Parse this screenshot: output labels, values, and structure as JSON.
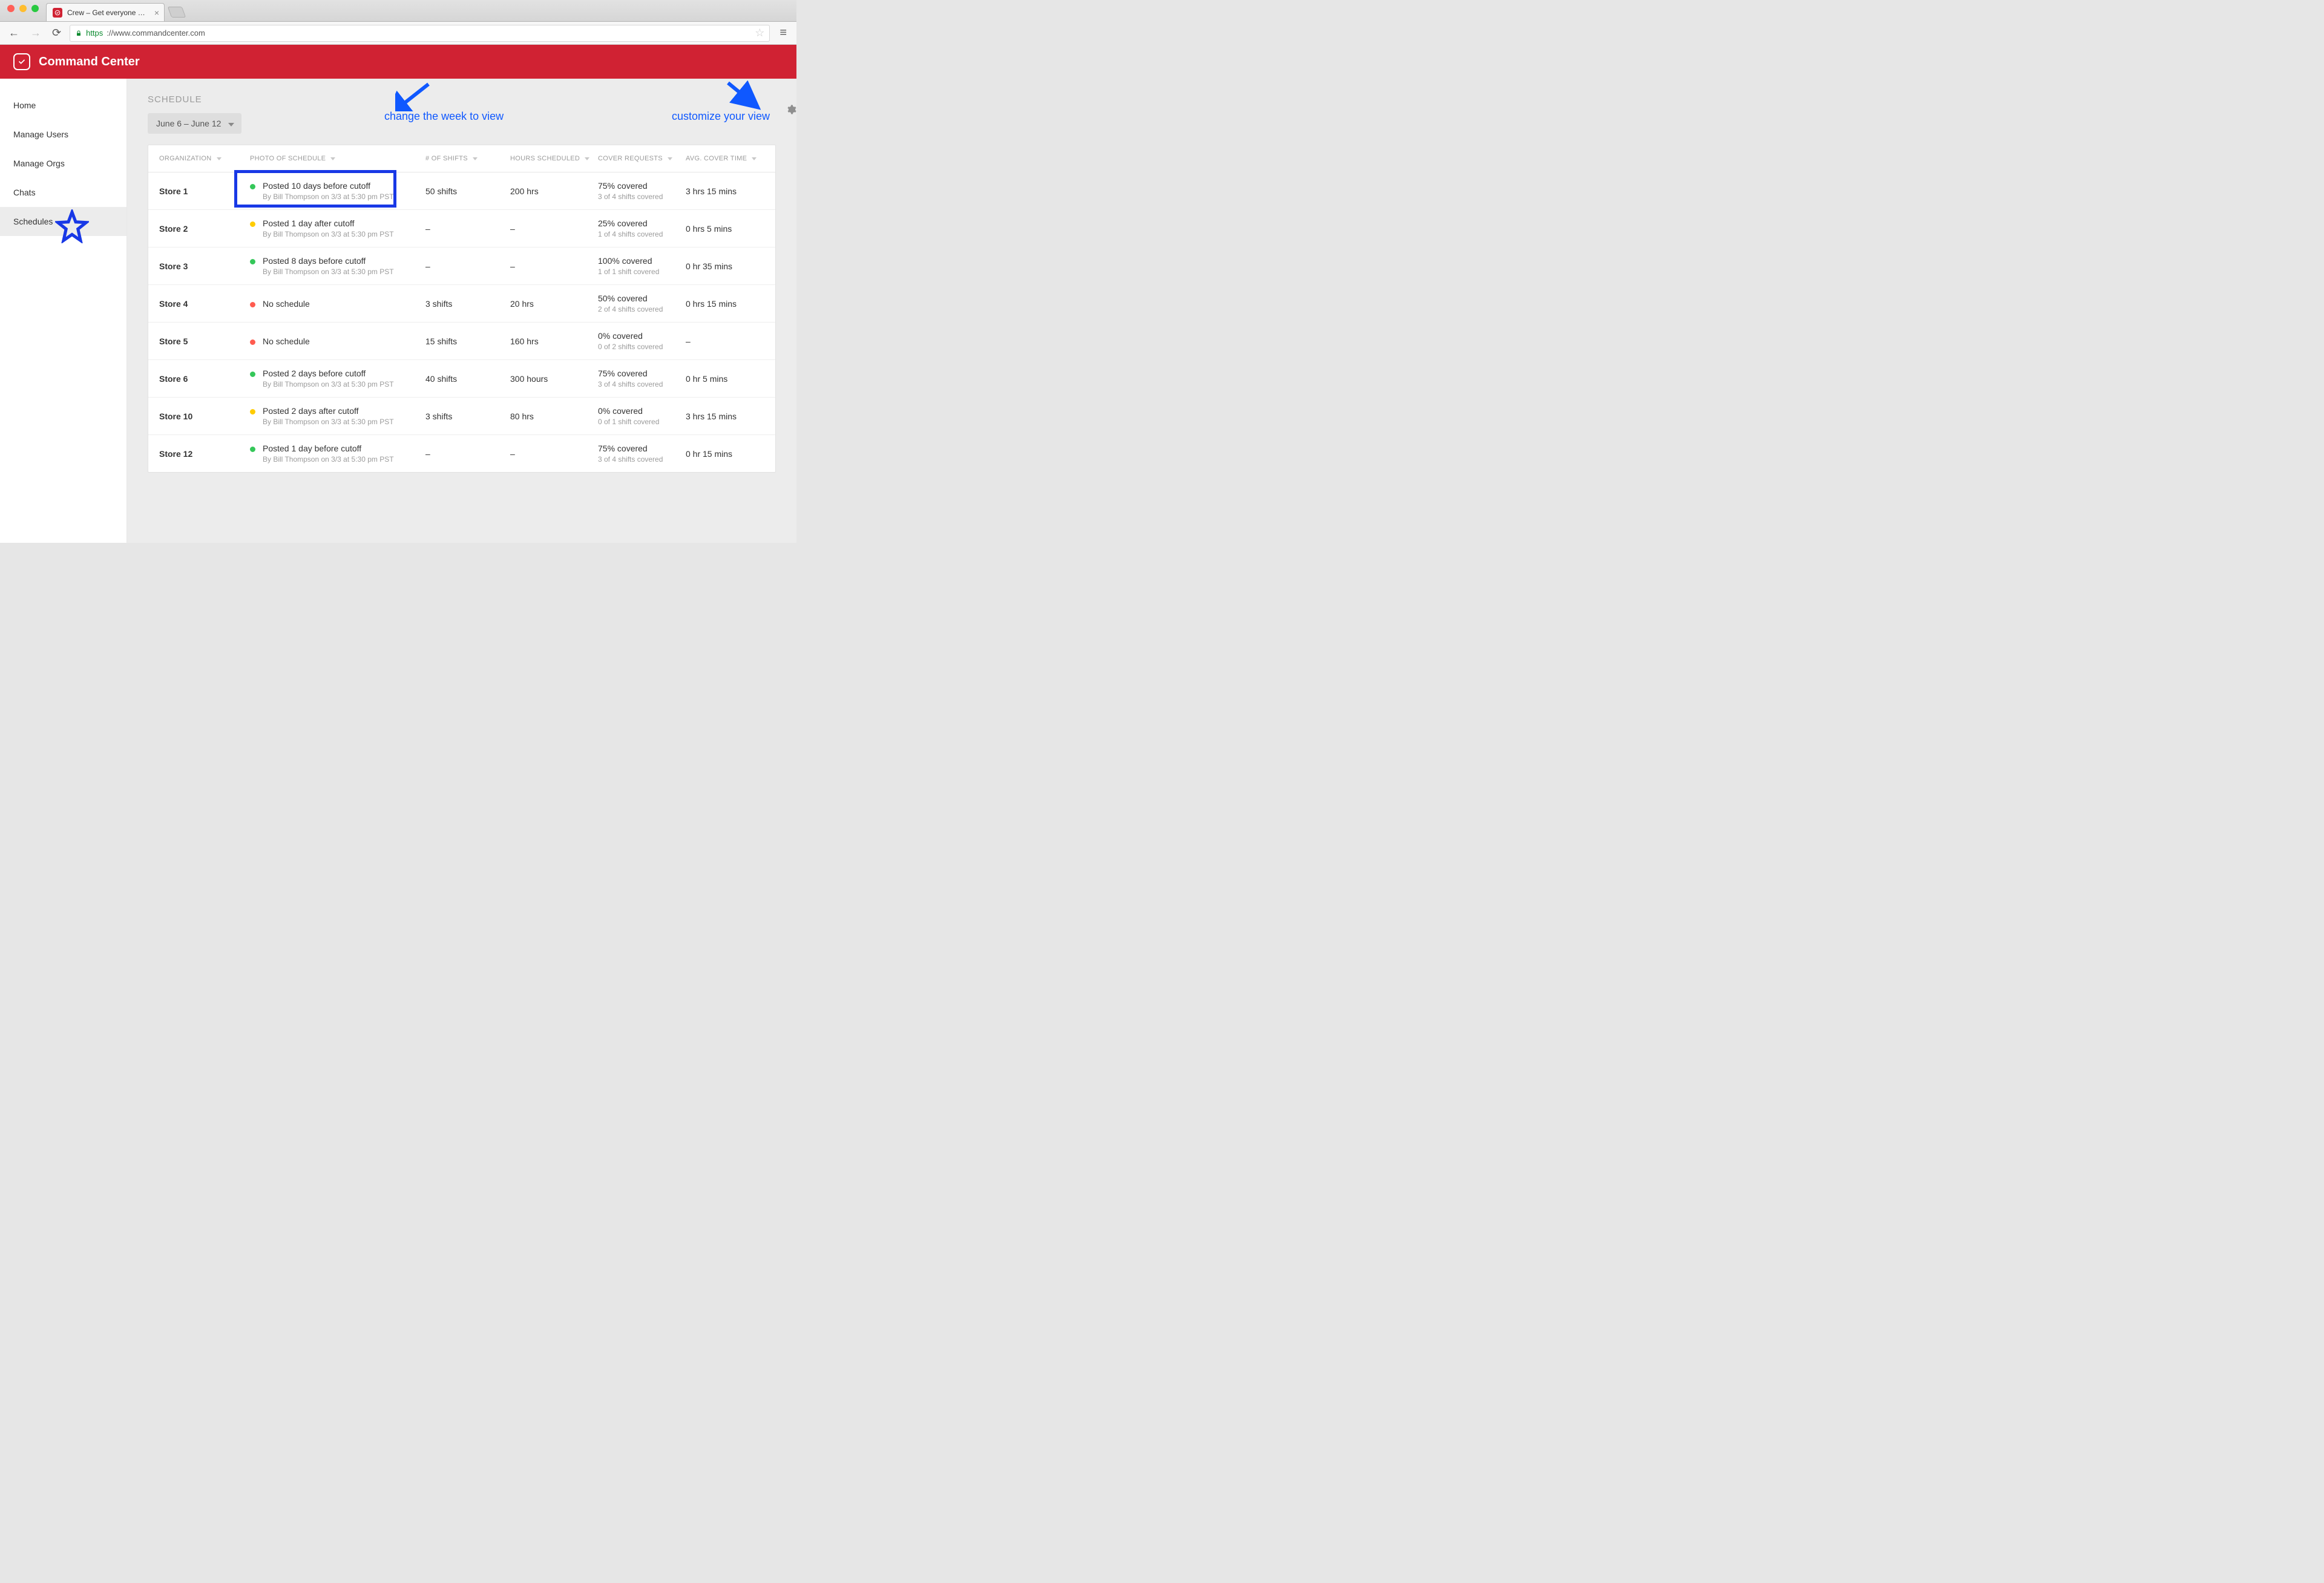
{
  "browser": {
    "tab_title": "Crew – Get everyone on",
    "url_protocol": "https",
    "url_rest": "://www.commandcenter.com"
  },
  "header": {
    "title": "Command Center"
  },
  "sidebar": {
    "items": [
      {
        "label": "Home"
      },
      {
        "label": "Manage Users"
      },
      {
        "label": "Manage Orgs"
      },
      {
        "label": "Chats"
      },
      {
        "label": "Schedules"
      }
    ],
    "active_index": 4
  },
  "page": {
    "heading": "SCHEDULE",
    "week_range": "June 6 – June 12"
  },
  "annotations": {
    "change_week": "change the week to view",
    "customize": "customize your view"
  },
  "columns": {
    "org": "ORGANIZATION",
    "photo": "PHOTO OF SCHEDULE",
    "shifts": "# OF SHIFTS",
    "hours": "HOURS SCHEDULED",
    "cover": "COVER REQUESTS",
    "avg": "AVG. COVER TIME"
  },
  "rows": [
    {
      "org": "Store 1",
      "dot": "green",
      "main": "Posted 10 days before cutoff",
      "sub": "By Bill Thompson on 3/3 at 5:30 pm PST",
      "shifts": "50 shifts",
      "hours": "200 hrs",
      "cover_main": "75% covered",
      "cover_sub": "3 of 4 shifts covered",
      "avg": "3 hrs 15 mins",
      "highlighted": true
    },
    {
      "org": "Store 2",
      "dot": "yellow",
      "main": "Posted 1 day after cutoff",
      "sub": "By Bill Thompson on 3/3 at 5:30 pm PST",
      "shifts": "–",
      "hours": "–",
      "cover_main": "25% covered",
      "cover_sub": "1 of 4 shifts covered",
      "avg": "0 hrs 5 mins"
    },
    {
      "org": "Store 3",
      "dot": "green",
      "main": "Posted 8 days before cutoff",
      "sub": "By Bill Thompson on 3/3 at 5:30 pm PST",
      "shifts": "–",
      "hours": "–",
      "cover_main": "100% covered",
      "cover_sub": "1 of 1 shift covered",
      "avg": "0 hr 35 mins"
    },
    {
      "org": "Store 4",
      "dot": "red",
      "main": "No schedule",
      "sub": "",
      "shifts": "3 shifts",
      "hours": "20 hrs",
      "cover_main": "50% covered",
      "cover_sub": "2 of 4 shifts covered",
      "avg": "0 hrs 15 mins"
    },
    {
      "org": "Store 5",
      "dot": "red",
      "main": "No schedule",
      "sub": "",
      "shifts": "15 shifts",
      "hours": "160 hrs",
      "cover_main": "0% covered",
      "cover_sub": "0 of 2 shifts covered",
      "avg": "–"
    },
    {
      "org": "Store 6",
      "dot": "green",
      "main": "Posted 2 days before cutoff",
      "sub": "By Bill Thompson on 3/3 at 5:30 pm PST",
      "shifts": "40 shifts",
      "hours": "300 hours",
      "cover_main": "75% covered",
      "cover_sub": "3 of 4 shifts covered",
      "avg": "0 hr 5 mins"
    },
    {
      "org": "Store 10",
      "dot": "yellow",
      "main": "Posted 2 days after cutoff",
      "sub": "By Bill Thompson on 3/3 at 5:30 pm PST",
      "shifts": "3 shifts",
      "hours": "80 hrs",
      "cover_main": "0% covered",
      "cover_sub": "0 of 1 shift covered",
      "avg": "3 hrs 15 mins"
    },
    {
      "org": "Store 12",
      "dot": "green",
      "main": "Posted 1 day before cutoff",
      "sub": "By Bill Thompson on 3/3 at 5:30 pm PST",
      "shifts": "–",
      "hours": "–",
      "cover_main": "75% covered",
      "cover_sub": "3 of 4 shifts covered",
      "avg": "0 hr 15 mins"
    }
  ]
}
